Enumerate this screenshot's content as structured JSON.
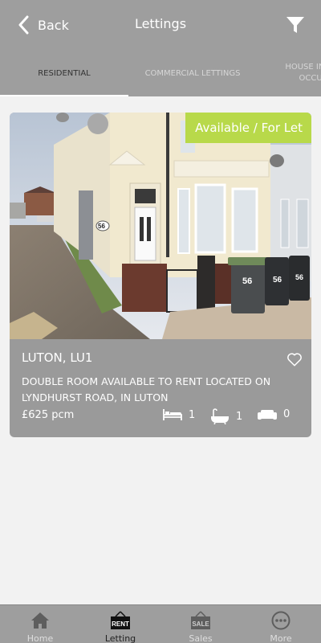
{
  "header": {
    "back_label": "Back",
    "title": "Lettings"
  },
  "tabs": [
    {
      "label": "RESIDENTIAL",
      "active": true
    },
    {
      "label": "COMMERCIAL LETTINGS",
      "active": false
    },
    {
      "label": "HOUSE IN MULTIPLE OCCUPATION",
      "active": false
    }
  ],
  "listing": {
    "status": "Available / For Let",
    "city": "LUTON, LU1",
    "description": "DOUBLE ROOM AVAILABLE TO RENT LOCATED ON LYNDHURST ROAD, IN LUTON",
    "price": "£625 pcm",
    "bedrooms": "1",
    "bathrooms": "1",
    "living_rooms": "0",
    "house_number": "56",
    "bin_labels": [
      "56",
      "56",
      "56"
    ]
  },
  "bottom_nav": [
    {
      "label": "Home",
      "icon": "home-icon",
      "active": false
    },
    {
      "label": "Letting",
      "icon": "rent-sign-icon",
      "icon_text": "RENT",
      "active": true
    },
    {
      "label": "Sales",
      "icon": "sale-sign-icon",
      "icon_text": "SALE",
      "active": false
    },
    {
      "label": "More",
      "icon": "more-icon",
      "active": false
    }
  ],
  "colors": {
    "header_bg": "#9e9e9e",
    "card_bg": "#9a9a9a",
    "badge_bg": "#b8d94a",
    "page_bg": "#f2f2f2"
  }
}
